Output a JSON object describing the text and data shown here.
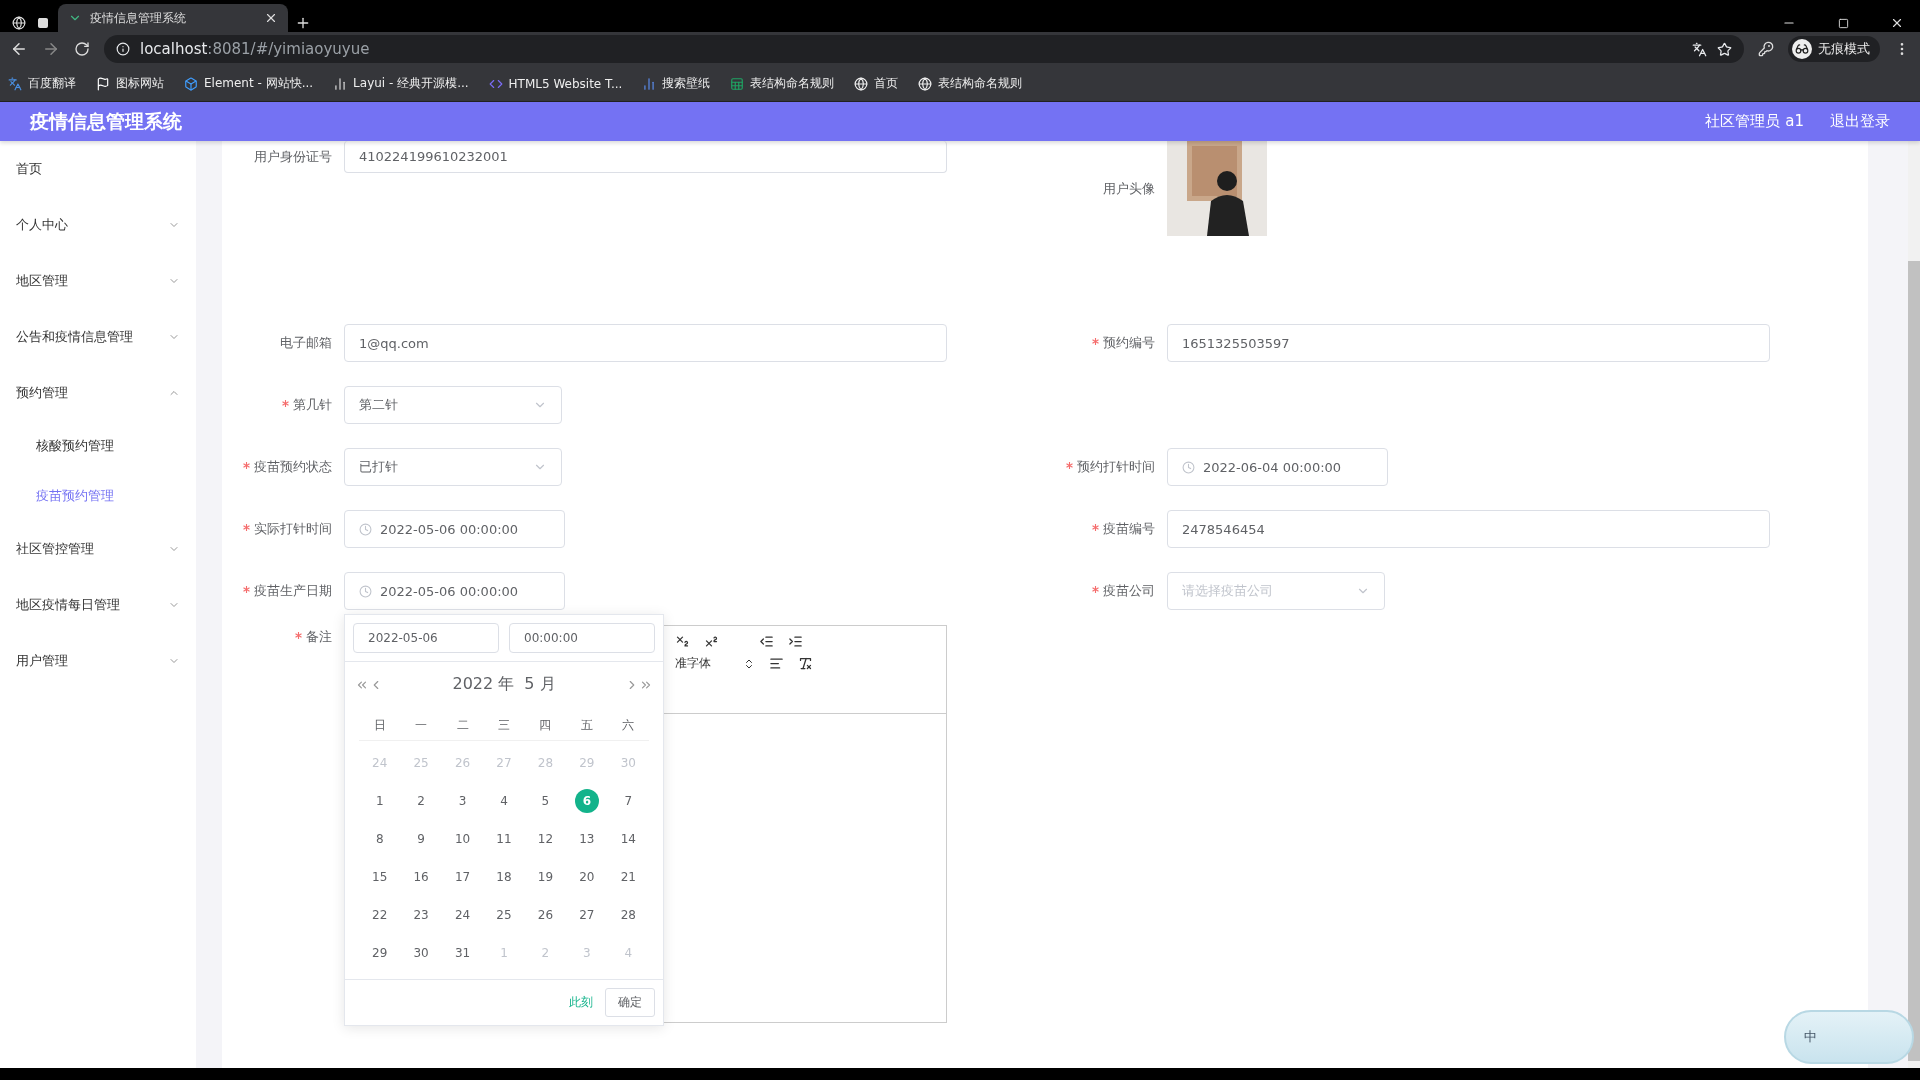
{
  "browser": {
    "tabs": [
      {
        "title": "疫情信息管理系统",
        "selected": true
      }
    ],
    "address": {
      "host": "localhost",
      "rest": ":8081/#/yimiaoyuyue"
    },
    "profile": "无痕模式",
    "bookmarks": [
      {
        "kind": "translate",
        "label": "百度翻译"
      },
      {
        "kind": "flag",
        "label": "图标网站"
      },
      {
        "kind": "cube",
        "label": "Element - 网站快..."
      },
      {
        "kind": "layui",
        "label": "Layui - 经典开源模..."
      },
      {
        "kind": "html5",
        "label": "HTML5 Website T..."
      },
      {
        "kind": "bars",
        "label": "搜索壁纸"
      },
      {
        "kind": "sheet",
        "label": "表结构命名规则"
      },
      {
        "kind": "globe",
        "label": "首页"
      },
      {
        "kind": "globe",
        "label": "表结构命名规则"
      }
    ]
  },
  "header": {
    "title": "疫情信息管理系统",
    "user": "社区管理员 a1",
    "logout": "退出登录"
  },
  "sidebar": [
    {
      "label": "首页",
      "selected": false
    },
    {
      "label": "个人中心",
      "expanded": false,
      "selected": false
    },
    {
      "label": "地区管理",
      "expanded": false,
      "selected": false
    },
    {
      "label": "公告和疫情信息管理",
      "expanded": false,
      "selected": false
    },
    {
      "label": "预约管理",
      "expanded": true,
      "selected": false,
      "children": [
        {
          "label": "核酸预约管理",
          "selected": false
        },
        {
          "label": "疫苗预约管理",
          "selected": true
        }
      ]
    },
    {
      "label": "社区管控管理",
      "expanded": false,
      "selected": false
    },
    {
      "label": "地区疫情每日管理",
      "expanded": false,
      "selected": false
    },
    {
      "label": "用户管理",
      "expanded": false,
      "selected": false
    }
  ],
  "form": {
    "rows": [
      {
        "left": {
          "kind": "text",
          "label": "用户身份证号",
          "value": "410224199610232001"
        },
        "right": {
          "kind": "avatar",
          "label": "用户头像"
        }
      },
      {
        "left": {
          "kind": "text",
          "label": "电子邮箱",
          "value": "1@qq.com"
        },
        "right": {
          "kind": "text",
          "label": "预约编号",
          "required": true,
          "value": "1651325503597"
        }
      },
      {
        "left": {
          "kind": "select",
          "label": "第几针",
          "required": true,
          "value": "第二针"
        }
      },
      {
        "left": {
          "kind": "select",
          "label": "疫苗预约状态",
          "required": true,
          "value": "已打针"
        },
        "right": {
          "kind": "datetime",
          "label": "预约打针时间",
          "required": true,
          "value": "2022-06-04 00:00:00"
        }
      },
      {
        "left": {
          "kind": "datetime",
          "label": "实际打针时间",
          "required": true,
          "value": "2022-05-06 00:00:00"
        },
        "right": {
          "kind": "text",
          "label": "疫苗编号",
          "required": true,
          "value": "2478546454"
        }
      },
      {
        "left": {
          "kind": "datetime",
          "label": "疫苗生产日期",
          "required": true,
          "value": "2022-05-06 00:00:00"
        },
        "right": {
          "kind": "select",
          "label": "疫苗公司",
          "required": true,
          "placeholder": "请选择疫苗公司"
        }
      }
    ],
    "note": {
      "label": "备注",
      "required": true,
      "font_select": "准字体"
    }
  },
  "date_picker": {
    "date": "2022-05-06",
    "time": "00:00:00",
    "year": "2022 年",
    "month": "5 月",
    "weekdays": [
      "日",
      "一",
      "二",
      "三",
      "四",
      "五",
      "六"
    ],
    "days": [
      {
        "d": "24",
        "kind": "other",
        "selected": false
      },
      {
        "d": "25",
        "kind": "other",
        "selected": false
      },
      {
        "d": "26",
        "kind": "other",
        "selected": false
      },
      {
        "d": "27",
        "kind": "other",
        "selected": false
      },
      {
        "d": "28",
        "kind": "other",
        "selected": false
      },
      {
        "d": "29",
        "kind": "other",
        "selected": false
      },
      {
        "d": "30",
        "kind": "other",
        "selected": false
      },
      {
        "d": "1",
        "kind": "current",
        "selected": false
      },
      {
        "d": "2",
        "kind": "current",
        "selected": false
      },
      {
        "d": "3",
        "kind": "current",
        "selected": false
      },
      {
        "d": "4",
        "kind": "current",
        "selected": false
      },
      {
        "d": "5",
        "kind": "current",
        "selected": false
      },
      {
        "d": "6",
        "kind": "current",
        "selected": true
      },
      {
        "d": "7",
        "kind": "current",
        "selected": false
      },
      {
        "d": "8",
        "kind": "current",
        "selected": false
      },
      {
        "d": "9",
        "kind": "current",
        "selected": false
      },
      {
        "d": "10",
        "kind": "current",
        "selected": false
      },
      {
        "d": "11",
        "kind": "current",
        "selected": false
      },
      {
        "d": "12",
        "kind": "current",
        "selected": false
      },
      {
        "d": "13",
        "kind": "current",
        "selected": false
      },
      {
        "d": "14",
        "kind": "current",
        "selected": false
      },
      {
        "d": "15",
        "kind": "current",
        "selected": false
      },
      {
        "d": "16",
        "kind": "current",
        "selected": false
      },
      {
        "d": "17",
        "kind": "current",
        "selected": false
      },
      {
        "d": "18",
        "kind": "current",
        "selected": false
      },
      {
        "d": "19",
        "kind": "current",
        "selected": false
      },
      {
        "d": "20",
        "kind": "current",
        "selected": false
      },
      {
        "d": "21",
        "kind": "current",
        "selected": false
      },
      {
        "d": "22",
        "kind": "current",
        "selected": false
      },
      {
        "d": "23",
        "kind": "current",
        "selected": false
      },
      {
        "d": "24",
        "kind": "current",
        "selected": false
      },
      {
        "d": "25",
        "kind": "current",
        "selected": false
      },
      {
        "d": "26",
        "kind": "current",
        "selected": false
      },
      {
        "d": "27",
        "kind": "current",
        "selected": false
      },
      {
        "d": "28",
        "kind": "current",
        "selected": false
      },
      {
        "d": "29",
        "kind": "current",
        "selected": false
      },
      {
        "d": "30",
        "kind": "current",
        "selected": false
      },
      {
        "d": "31",
        "kind": "current",
        "selected": false
      },
      {
        "d": "1",
        "kind": "other",
        "selected": false
      },
      {
        "d": "2",
        "kind": "other",
        "selected": false
      },
      {
        "d": "3",
        "kind": "other",
        "selected": false
      },
      {
        "d": "4",
        "kind": "other",
        "selected": false
      }
    ],
    "now": "此刻",
    "ok": "确定"
  },
  "ime": {
    "mode": "中"
  }
}
